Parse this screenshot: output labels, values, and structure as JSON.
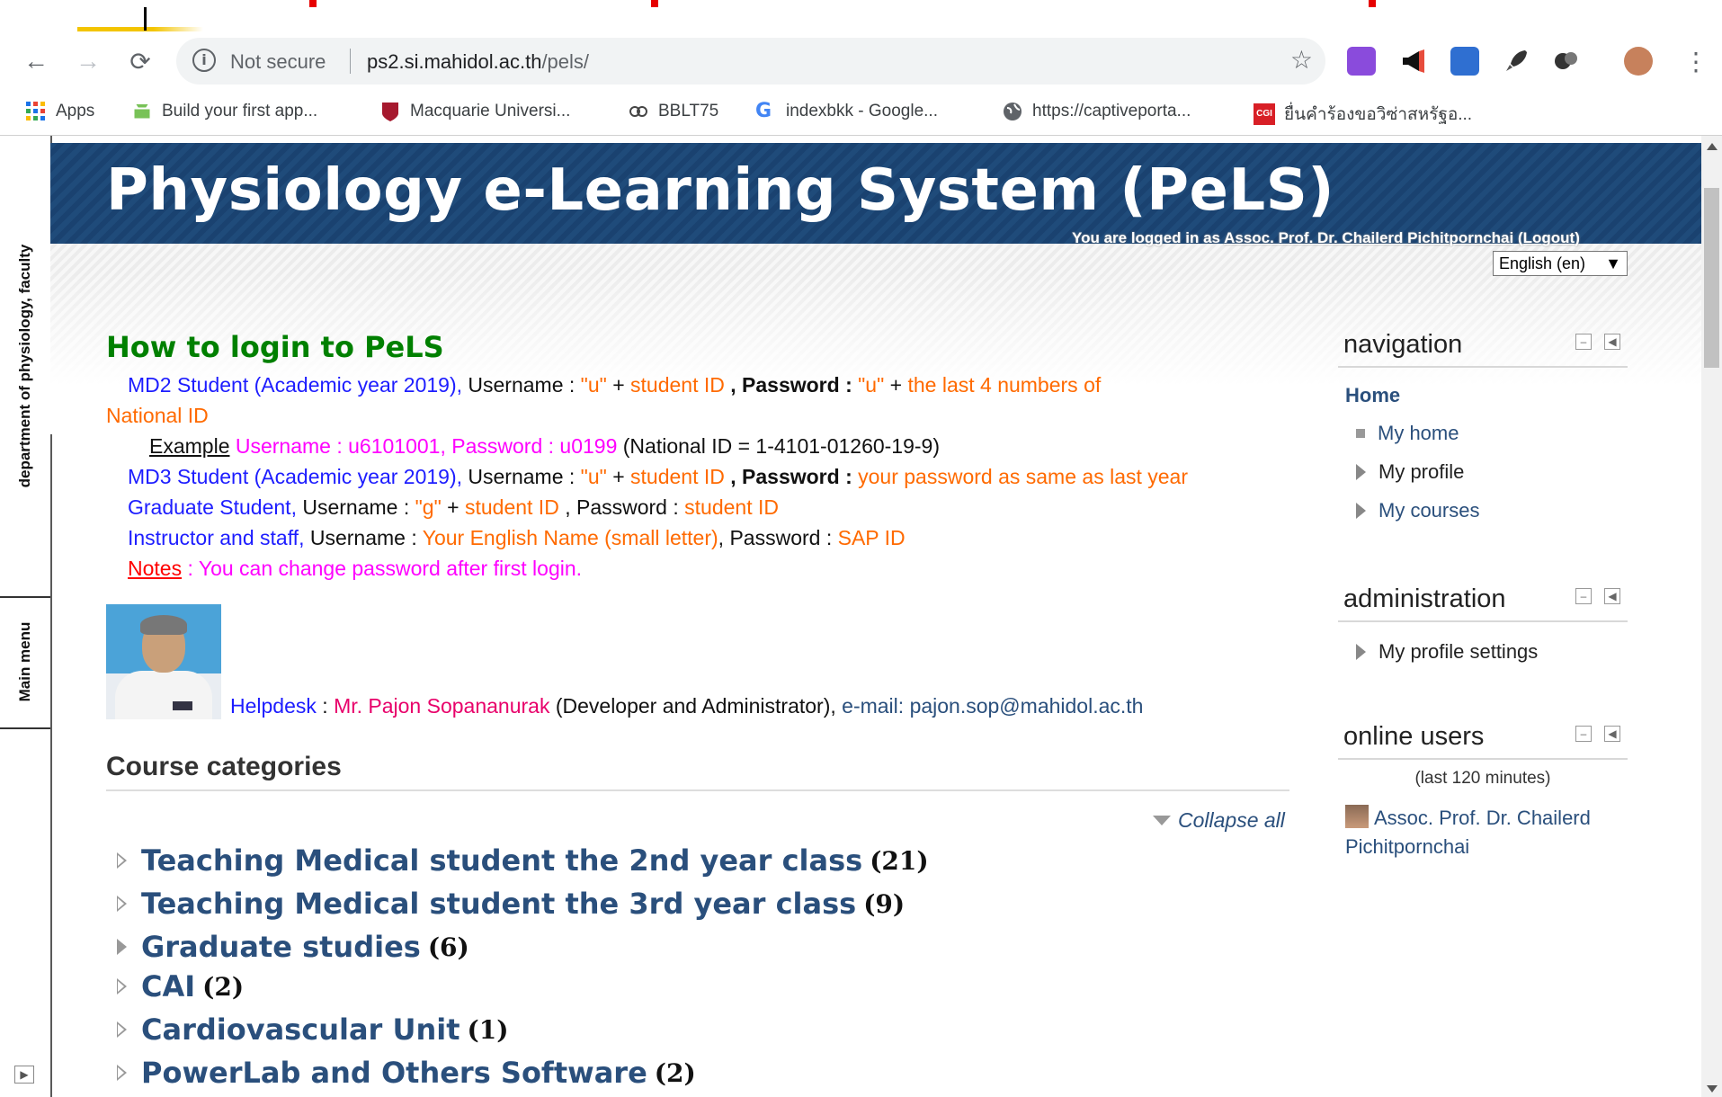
{
  "browser": {
    "security_label": "Not secure",
    "url_host": "ps2.si.mahidol.ac.th",
    "url_path": "/pels/"
  },
  "bookmarks": [
    {
      "label": "Apps",
      "icon": "apps-grid-icon"
    },
    {
      "label": "Build your first app...",
      "icon": "android-icon"
    },
    {
      "label": "Macquarie Universi...",
      "icon": "shield-icon"
    },
    {
      "label": "BBLT75",
      "icon": "rings-icon"
    },
    {
      "label": "indexbkk - Google...",
      "icon": "google-icon"
    },
    {
      "label": "https://captiveporta...",
      "icon": "globe-icon"
    },
    {
      "label": "ยื่นคำร้องขอวิซ่าสหรัฐอ...",
      "icon": "cgi-icon"
    }
  ],
  "dock": {
    "tab1": "department of physiology, faculty",
    "tab2": "Main menu"
  },
  "header": {
    "title": "Physiology e-Learning System (PeLS)",
    "login_prefix": "You are logged in as ",
    "login_user": "Assoc. Prof. Dr. Chailerd Pichitpornchai",
    "login_logout": "(Logout)",
    "language": "English (en)"
  },
  "howto": {
    "title": "How to login to PeLS",
    "md2": {
      "who": "MD2 Student (Academic year 2019),",
      "u_label": " Username : ",
      "u_val1": " \"u\" ",
      "plus": "+",
      "u_val2": " student ID ",
      "p_label": ", Password : ",
      "p_val1": "\"u\" ",
      "p_val2": " the last 4 numbers of",
      "p_val3": "National ID"
    },
    "example": {
      "label": "Example",
      "text": " Username : u6101001, Password : u0199",
      "note": " (National ID = 1-4101-01260-19-9)"
    },
    "md3": {
      "who": "MD3 Student (Academic year 2019),",
      "u_label": " Username : ",
      "u_val1": "\"u\" ",
      "u_val2": " student ID ",
      "p_label": ", Password : ",
      "p_val": "your password as same as last year"
    },
    "grad": {
      "who": "Graduate Student,",
      "u_label": " Username : ",
      "u_val1": "\"g\" ",
      "u_val2": " student ID ",
      "p_label": ", Password : ",
      "p_val": "student ID"
    },
    "staff": {
      "who": "Instructor and staff,",
      "u_label": " Username : ",
      "u_val": "Your English Name (small letter)",
      "p_label": ", Password : ",
      "p_val": "SAP ID"
    },
    "notes": {
      "label": "Notes",
      "text": " : You can change password after first login."
    }
  },
  "helpdesk": {
    "label": "Helpdesk",
    "colon": " : ",
    "name": "Mr. Pajon Sopananurak",
    "role": " (Developer and Administrator), ",
    "email_label": "e-mail: ",
    "email": "pajon.sop@mahidol.ac.th"
  },
  "categories": {
    "title": "Course categories",
    "collapse_label": "Collapse all",
    "items": [
      {
        "name": "Teaching Medical student the 2nd year class",
        "count": "(21)"
      },
      {
        "name": "Teaching Medical student the 3rd year class",
        "count": "(9)"
      },
      {
        "name": "Graduate studies",
        "count": "(6)"
      },
      {
        "name": "CAI",
        "count": "(2)"
      },
      {
        "name": "Cardiovascular Unit",
        "count": "(1)"
      },
      {
        "name": "PowerLab and Others Software",
        "count": "(2)"
      }
    ]
  },
  "navigation": {
    "title": "navigation",
    "home": "Home",
    "items": [
      "My home",
      "My profile",
      "My courses"
    ]
  },
  "administration": {
    "title": "administration",
    "items": [
      "My profile settings"
    ]
  },
  "online_users": {
    "title": "online users",
    "subtitle": "(last 120 minutes)",
    "user": "Assoc. Prof. Dr. Chailerd Pichitpornchai"
  },
  "colors": {
    "banner": "#1f4b7a",
    "heading_green": "#008000",
    "link": "#2a4f7c",
    "label_blue": "#1d1dff",
    "value_orange": "#ff6a00",
    "example_magenta": "#ff00ff"
  }
}
